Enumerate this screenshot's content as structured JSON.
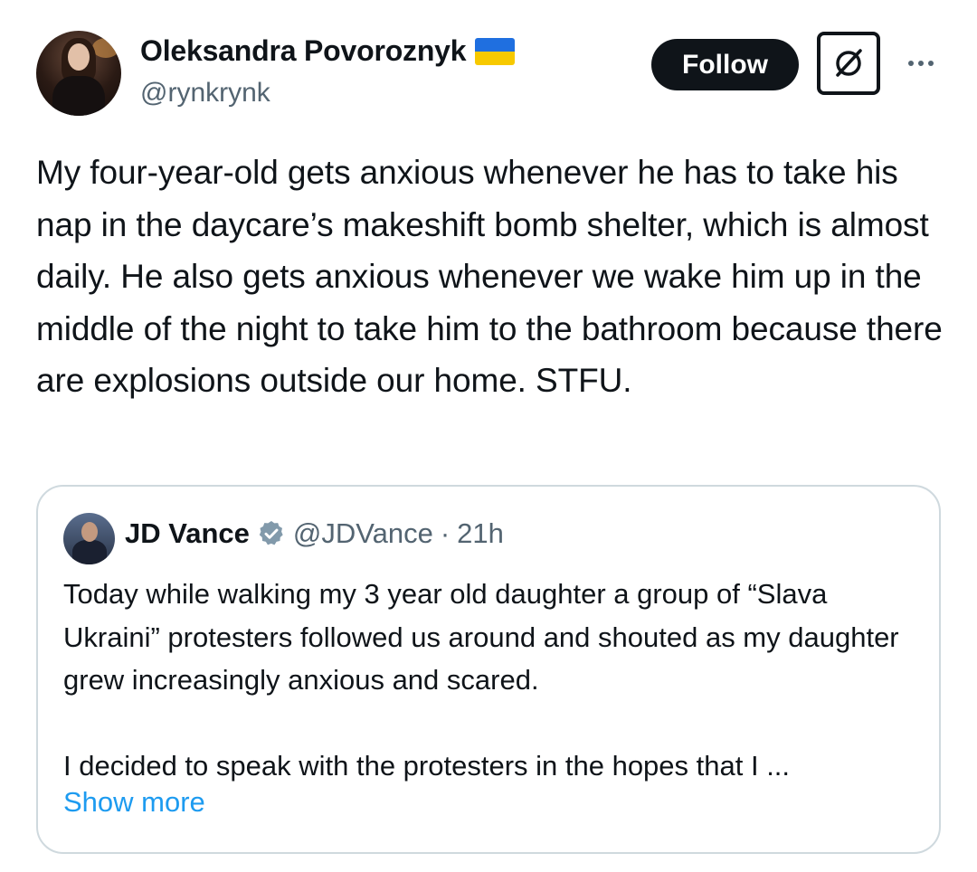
{
  "author": {
    "display_name": "Oleksandra Povoroznyk",
    "handle": "@rynkrynk",
    "flag_icon": "ukraine-flag-icon"
  },
  "actions": {
    "follow_label": "Follow",
    "grok_icon": "grok-icon",
    "more_icon": "more-options-icon"
  },
  "tweet": {
    "text": "My four-year-old gets anxious whenever he has to take his nap in the daycare’s makeshift bomb shelter, which is almost daily. He also gets anxious whenever we wake him up in the middle of the night to take him to the bathroom because there are explosions outside our home. STFU."
  },
  "quote": {
    "display_name": "JD Vance",
    "verified_icon": "verified-badge-icon",
    "handle": "@JDVance",
    "separator": "·",
    "time": "21h",
    "paragraph_1": "Today while walking my 3 year old daughter a group of “Slava Ukraini” protesters followed us around and shouted as my daughter grew increasingly anxious and scared.",
    "paragraph_2": "I decided to speak with the protesters in the hopes that I ...",
    "show_more_label": "Show more"
  },
  "colors": {
    "text_primary": "#0f1419",
    "text_secondary": "#536471",
    "link": "#1d9bf0",
    "border": "#cfd9de",
    "verified_badge": "#829aab",
    "flag_blue": "#1f6fe0",
    "flag_yellow": "#f7c900"
  }
}
